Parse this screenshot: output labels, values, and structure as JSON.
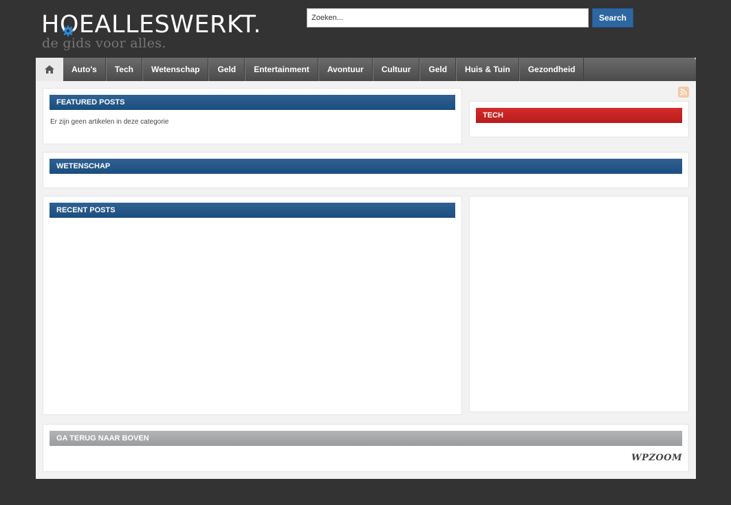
{
  "logo": {
    "text_before": "H",
    "text_o": "O",
    "text_after": "EALLESWERKT.",
    "tagline": "de gids voor alles."
  },
  "search": {
    "placeholder": "Zoeken...",
    "button_label": "Search"
  },
  "nav": {
    "home_icon": "home-icon",
    "items": [
      {
        "label": "Auto's"
      },
      {
        "label": "Tech"
      },
      {
        "label": "Wetenschap"
      },
      {
        "label": "Geld"
      },
      {
        "label": "Entertainment"
      },
      {
        "label": "Avontuur"
      },
      {
        "label": "Cultuur"
      },
      {
        "label": "Geld"
      },
      {
        "label": "Huis & Tuin"
      },
      {
        "label": "Gezondheid"
      }
    ]
  },
  "featured": {
    "title": "FEATURED POSTS",
    "empty_message": "Er zijn geen artikelen in deze categorie"
  },
  "tech": {
    "title": "TECH"
  },
  "wetenschap": {
    "title": "WETENSCHAP"
  },
  "recent": {
    "title": "RECENT POSTS"
  },
  "footer": {
    "back_to_top": "GA TERUG NAAR BOVEN",
    "credit": "WPZOOM"
  },
  "colors": {
    "background": "#333333",
    "accent_blue": "#1f5283",
    "accent_red": "#c62222",
    "search_button": "#2d67a3"
  }
}
